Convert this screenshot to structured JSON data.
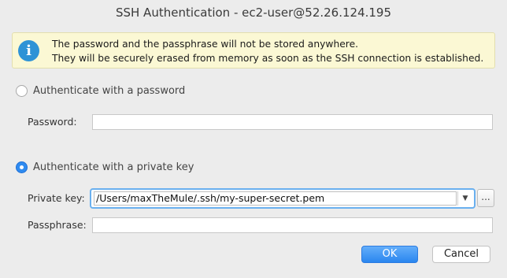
{
  "window": {
    "title": "SSH Authentication - ec2-user@52.26.124.195"
  },
  "info": {
    "icon": "info-icon",
    "line1": "The password and the passphrase will not be stored anywhere.",
    "line2": "They will be securely erased from memory as soon as the SSH connection is established."
  },
  "auth_password": {
    "label": "Authenticate with a password",
    "selected": false,
    "password_label": "Password:",
    "password_value": ""
  },
  "auth_key": {
    "label": "Authenticate with a private key",
    "selected": true,
    "private_key_label": "Private key:",
    "private_key_value": "/Users/maxTheMule/.ssh/my-super-secret.pem",
    "browse_label": "...",
    "passphrase_label": "Passphrase:",
    "passphrase_value": ""
  },
  "buttons": {
    "ok": "OK",
    "cancel": "Cancel"
  },
  "colors": {
    "accent": "#2f8bf0",
    "info_bg": "#fbf8d4",
    "info_icon": "#2f93d6"
  }
}
